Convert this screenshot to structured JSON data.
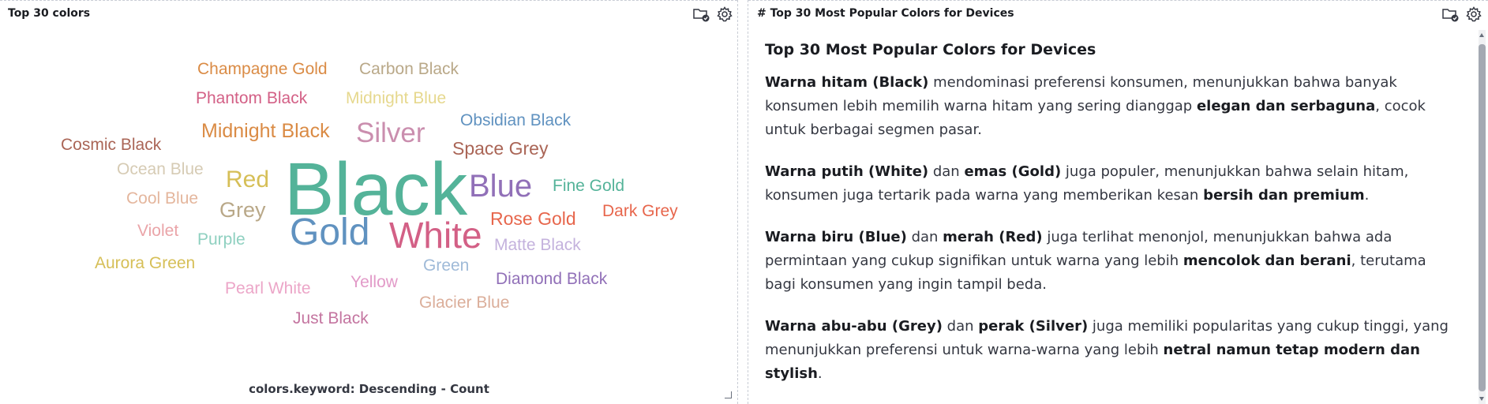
{
  "left_panel": {
    "title": "Top 30 colors",
    "caption": "colors.keyword: Descending - Count",
    "words": [
      {
        "text": "Black",
        "weight": 100,
        "color": "#54b399"
      },
      {
        "text": "Gold",
        "weight": 62,
        "color": "#6092c0"
      },
      {
        "text": "White",
        "weight": 60,
        "color": "#d36086"
      },
      {
        "text": "Blue",
        "weight": 45,
        "color": "#9170b8"
      },
      {
        "text": "Silver",
        "weight": 42,
        "color": "#ca8eae"
      },
      {
        "text": "Red",
        "weight": 36,
        "color": "#d6bf57"
      },
      {
        "text": "Grey",
        "weight": 33,
        "color": "#b9a888"
      },
      {
        "text": "Midnight Black",
        "weight": 30,
        "color": "#da8b45"
      },
      {
        "text": "Space Grey",
        "weight": 27,
        "color": "#aa6556"
      },
      {
        "text": "Rose Gold",
        "weight": 27,
        "color": "#e7664c"
      },
      {
        "text": "Obsidian Black",
        "weight": 26,
        "color": "#6092c0"
      },
      {
        "text": "Champagne Gold",
        "weight": 26,
        "color": "#da8b45"
      },
      {
        "text": "Carbon Black",
        "weight": 26,
        "color": "#b9a888"
      },
      {
        "text": "Phantom Black",
        "weight": 25,
        "color": "#d36086"
      },
      {
        "text": "Cosmic Black",
        "weight": 25,
        "color": "#aa6556"
      },
      {
        "text": "Dark Grey",
        "weight": 25,
        "color": "#e7664c"
      },
      {
        "text": "Fine Gold",
        "weight": 25,
        "color": "#54b399"
      },
      {
        "text": "Midnight Blue",
        "weight": 24,
        "color": "#e6d88e"
      },
      {
        "text": "Ocean Blue",
        "weight": 24,
        "color": "#d6cbb4"
      },
      {
        "text": "Cool Blue",
        "weight": 24,
        "color": "#e4b69d"
      },
      {
        "text": "Violet",
        "weight": 24,
        "color": "#eaa4a8"
      },
      {
        "text": "Purple",
        "weight": 24,
        "color": "#8fd0c0"
      },
      {
        "text": "Matte Black",
        "weight": 24,
        "color": "#c4b2dd"
      },
      {
        "text": "Aurora Green",
        "weight": 24,
        "color": "#d6bf57"
      },
      {
        "text": "Green",
        "weight": 24,
        "color": "#9fbad8"
      },
      {
        "text": "Diamond Black",
        "weight": 24,
        "color": "#9170b8"
      },
      {
        "text": "Pearl White",
        "weight": 24,
        "color": "#eca6c8"
      },
      {
        "text": "Yellow",
        "weight": 24,
        "color": "#e29ac8"
      },
      {
        "text": "Glacier Blue",
        "weight": 24,
        "color": "#dbae9a"
      },
      {
        "text": "Just Black",
        "weight": 24,
        "color": "#c475a0"
      }
    ]
  },
  "right_panel": {
    "title": "# Top 30 Most Popular Colors for Devices",
    "heading": "Top 30 Most Popular Colors for Devices",
    "p1": {
      "b1": "Warna hitam (Black)",
      "t1": " mendominasi preferensi konsumen, menunjukkan bahwa banyak konsumen lebih memilih warna hitam yang sering dianggap ",
      "b2": "elegan dan serbaguna",
      "t2": ", cocok untuk berbagai segmen pasar."
    },
    "p2": {
      "b1": "Warna putih (White)",
      "t1": " dan ",
      "b2": "emas (Gold)",
      "t2": " juga populer, menunjukkan bahwa selain hitam, konsumen juga tertarik pada warna yang memberikan kesan ",
      "b3": "bersih dan premium",
      "t3": "."
    },
    "p3": {
      "b1": "Warna biru (Blue)",
      "t1": " dan ",
      "b2": "merah (Red)",
      "t2": " juga terlihat menonjol, menunjukkan bahwa ada permintaan yang cukup signifikan untuk warna yang lebih ",
      "b3": "mencolok dan berani",
      "t3": ", terutama bagi konsumen yang ingin tampil beda."
    },
    "p4": {
      "b1": "Warna abu-abu (Grey)",
      "t1": " dan ",
      "b2": "perak (Silver)",
      "t2": " juga memiliki popularitas yang cukup tinggi, yang menunjukkan preferensi untuk warna-warna yang lebih ",
      "b3": "netral namun tetap modern dan stylish",
      "t3": "."
    }
  },
  "icons": {
    "save": "folder-check-icon",
    "settings": "gear-icon",
    "resize": "resize-corner-icon"
  }
}
